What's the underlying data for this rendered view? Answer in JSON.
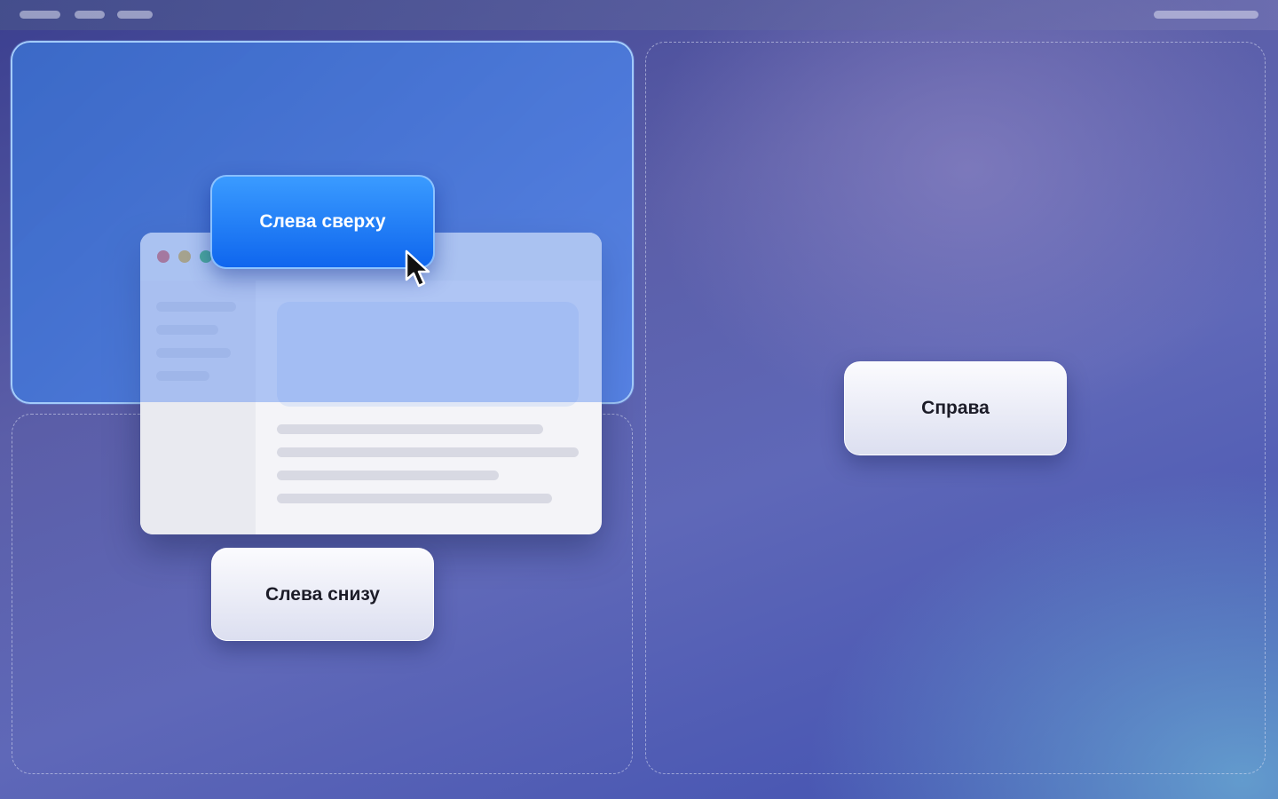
{
  "zones": {
    "top_left": {
      "label": "Слева сверху"
    },
    "bottom_left": {
      "label": "Слева снизу"
    },
    "right": {
      "label": "Справа"
    }
  },
  "icons": {
    "cursor": "arrow-cursor-icon",
    "window_controls": [
      "close-dot-icon",
      "minimize-dot-icon",
      "zoom-dot-icon"
    ]
  },
  "colors": {
    "active_button": "#1a73f5",
    "active_zone_border": "#aad2ff",
    "close": "#e0685f",
    "minimize": "#e2b43e",
    "zoom": "#3fbf5a"
  }
}
